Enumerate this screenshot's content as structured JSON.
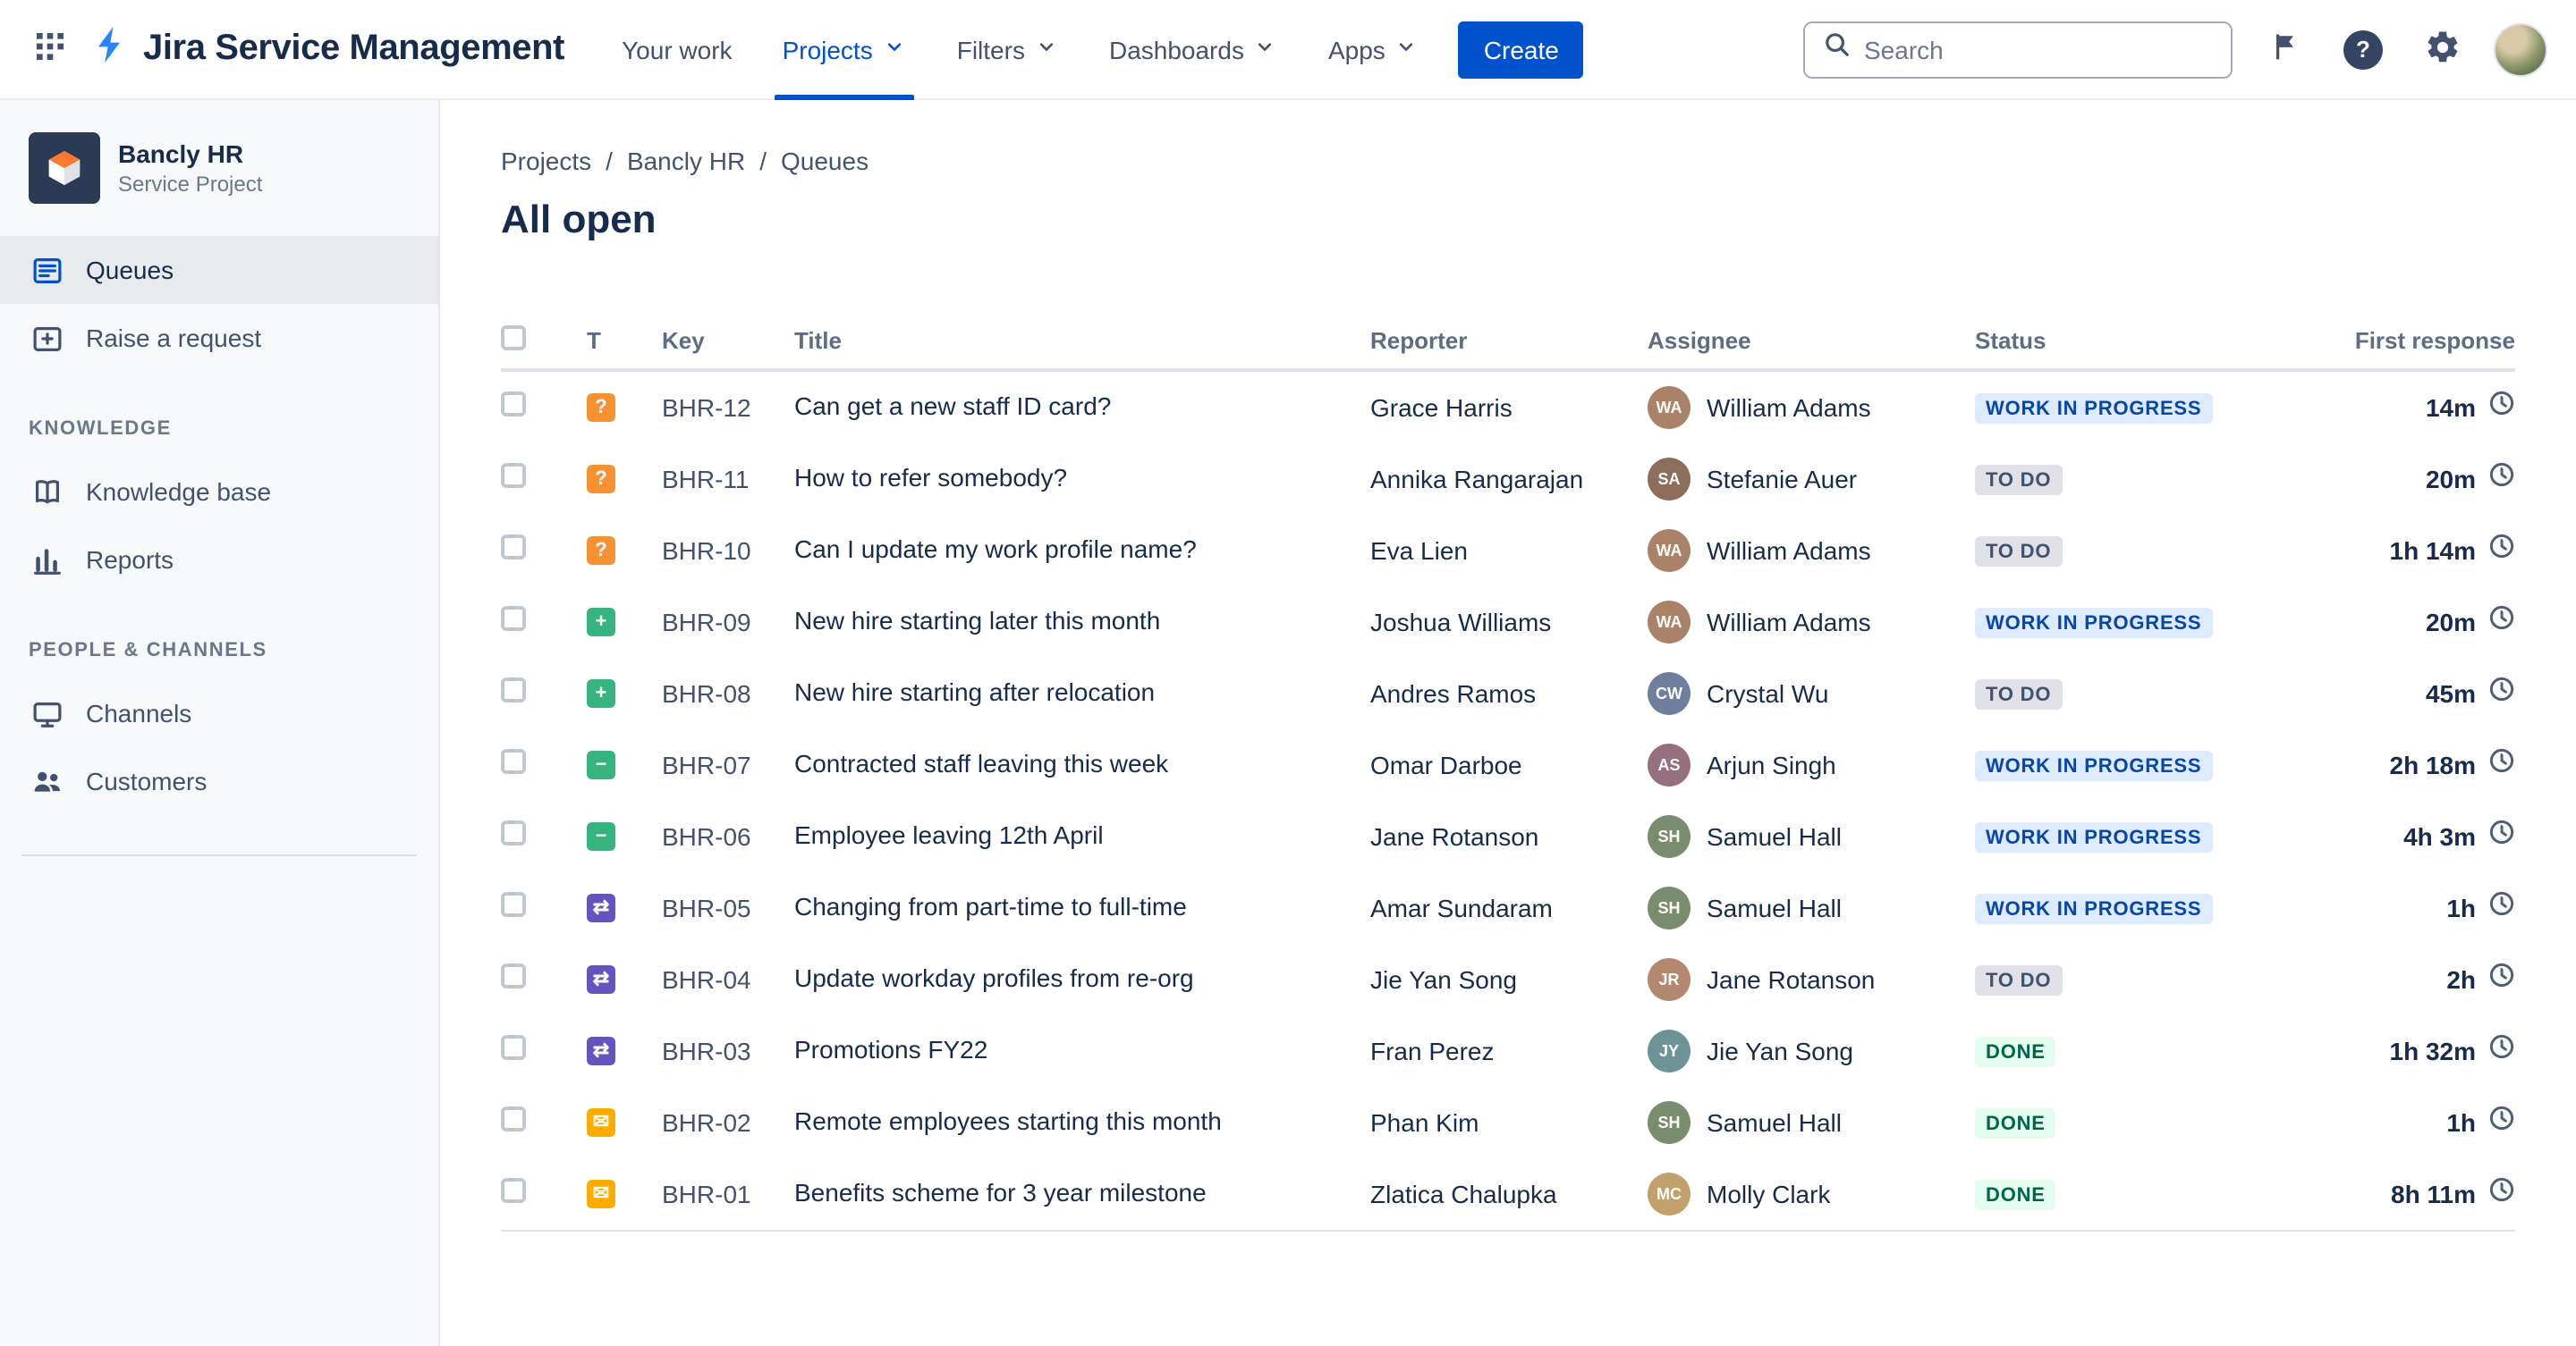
{
  "topbar": {
    "app_name": "Jira Service Management",
    "nav": [
      {
        "label": "Your work",
        "chevron": false,
        "active": false
      },
      {
        "label": "Projects",
        "chevron": true,
        "active": true
      },
      {
        "label": "Filters",
        "chevron": true,
        "active": false
      },
      {
        "label": "Dashboards",
        "chevron": true,
        "active": false
      },
      {
        "label": "Apps",
        "chevron": true,
        "active": false
      }
    ],
    "create_label": "Create",
    "search": {
      "placeholder": "Search"
    }
  },
  "sidebar": {
    "project": {
      "name": "Bancly HR",
      "type": "Service Project"
    },
    "items": [
      {
        "label": "Queues",
        "active": true
      },
      {
        "label": "Raise a request",
        "active": false
      }
    ],
    "sections": [
      {
        "title": "KNOWLEDGE",
        "items": [
          {
            "label": "Knowledge base"
          },
          {
            "label": "Reports"
          }
        ]
      },
      {
        "title": "PEOPLE & CHANNELS",
        "items": [
          {
            "label": "Channels"
          },
          {
            "label": "Customers"
          }
        ]
      }
    ]
  },
  "main": {
    "breadcrumb": [
      "Projects",
      "Bancly HR",
      "Queues"
    ],
    "title": "All open",
    "table": {
      "columns": [
        "T",
        "Key",
        "Title",
        "Reporter",
        "Assignee",
        "Status",
        "First response"
      ],
      "rows": [
        {
          "type": "question",
          "key": "BHR-12",
          "title": "Can get a new staff ID card?",
          "reporter": "Grace Harris",
          "assignee": "William Adams",
          "status": "WORK IN PROGRESS",
          "status_kind": "inprogress",
          "first_response": "14m"
        },
        {
          "type": "question",
          "key": "BHR-11",
          "title": "How to refer somebody?",
          "reporter": "Annika Rangarajan",
          "assignee": "Stefanie Auer",
          "status": "TO DO",
          "status_kind": "todo",
          "first_response": "20m"
        },
        {
          "type": "question",
          "key": "BHR-10",
          "title": "Can I update my work profile name?",
          "reporter": "Eva Lien",
          "assignee": "William Adams",
          "status": "TO DO",
          "status_kind": "todo",
          "first_response": "1h 14m"
        },
        {
          "type": "new-hire",
          "key": "BHR-09",
          "title": "New hire starting later this month",
          "reporter": "Joshua Williams",
          "assignee": "William Adams",
          "status": "WORK IN PROGRESS",
          "status_kind": "inprogress",
          "first_response": "20m"
        },
        {
          "type": "new-hire",
          "key": "BHR-08",
          "title": "New hire starting after relocation",
          "reporter": "Andres Ramos",
          "assignee": "Crystal Wu",
          "status": "TO DO",
          "status_kind": "todo",
          "first_response": "45m"
        },
        {
          "type": "leaver",
          "key": "BHR-07",
          "title": "Contracted staff leaving this week",
          "reporter": "Omar Darboe",
          "assignee": "Arjun Singh",
          "status": "WORK IN PROGRESS",
          "status_kind": "inprogress",
          "first_response": "2h 18m"
        },
        {
          "type": "leaver",
          "key": "BHR-06",
          "title": "Employee leaving 12th April",
          "reporter": "Jane Rotanson",
          "assignee": "Samuel Hall",
          "status": "WORK IN PROGRESS",
          "status_kind": "inprogress",
          "first_response": "4h 3m"
        },
        {
          "type": "change",
          "key": "BHR-05",
          "title": "Changing from part-time to full-time",
          "reporter": "Amar Sundaram",
          "assignee": "Samuel Hall",
          "status": "WORK IN PROGRESS",
          "status_kind": "inprogress",
          "first_response": "1h"
        },
        {
          "type": "change",
          "key": "BHR-04",
          "title": "Update workday profiles from re-org",
          "reporter": "Jie Yan Song",
          "assignee": "Jane Rotanson",
          "status": "TO DO",
          "status_kind": "todo",
          "first_response": "2h"
        },
        {
          "type": "change",
          "key": "BHR-03",
          "title": "Promotions FY22",
          "reporter": "Fran Perez",
          "assignee": "Jie Yan Song",
          "status": "DONE",
          "status_kind": "done",
          "first_response": "1h 32m"
        },
        {
          "type": "email",
          "key": "BHR-02",
          "title": "Remote employees starting this month",
          "reporter": "Phan Kim",
          "assignee": "Samuel Hall",
          "status": "DONE",
          "status_kind": "done",
          "first_response": "1h"
        },
        {
          "type": "email",
          "key": "BHR-01",
          "title": "Benefits scheme for 3 year milestone",
          "reporter": "Zlatica Chalupka",
          "assignee": "Molly Clark",
          "status": "DONE",
          "status_kind": "done",
          "first_response": "8h 11m"
        }
      ]
    }
  },
  "type_icons": {
    "question": {
      "name": "question-type-icon",
      "glyph": "?",
      "color": "#F79232"
    },
    "new-hire": {
      "name": "new-hire-type-icon",
      "glyph": "+",
      "color": "#36B37E"
    },
    "leaver": {
      "name": "leaver-type-icon",
      "glyph": "−",
      "color": "#36B37E"
    },
    "change": {
      "name": "change-type-icon",
      "glyph": "⇄",
      "color": "#6554C0"
    },
    "email": {
      "name": "email-type-icon",
      "glyph": "✉",
      "color": "#FFAB00"
    }
  },
  "colors": {
    "accent": "#0052CC",
    "brand_bolt": "#2684FF",
    "status_inprogress_bg": "#DEEBFF",
    "status_inprogress_text": "#0747A6",
    "status_todo_bg": "#DFE1E6",
    "status_todo_text": "#42526E",
    "status_done_bg": "#E3FCEF",
    "status_done_text": "#006644",
    "avatar_palette": [
      "#A98267",
      "#8C6E5A",
      "#6E7F9E",
      "#96707F",
      "#7A8C6E",
      "#B3886E",
      "#6E9396",
      "#C2A06B"
    ]
  }
}
